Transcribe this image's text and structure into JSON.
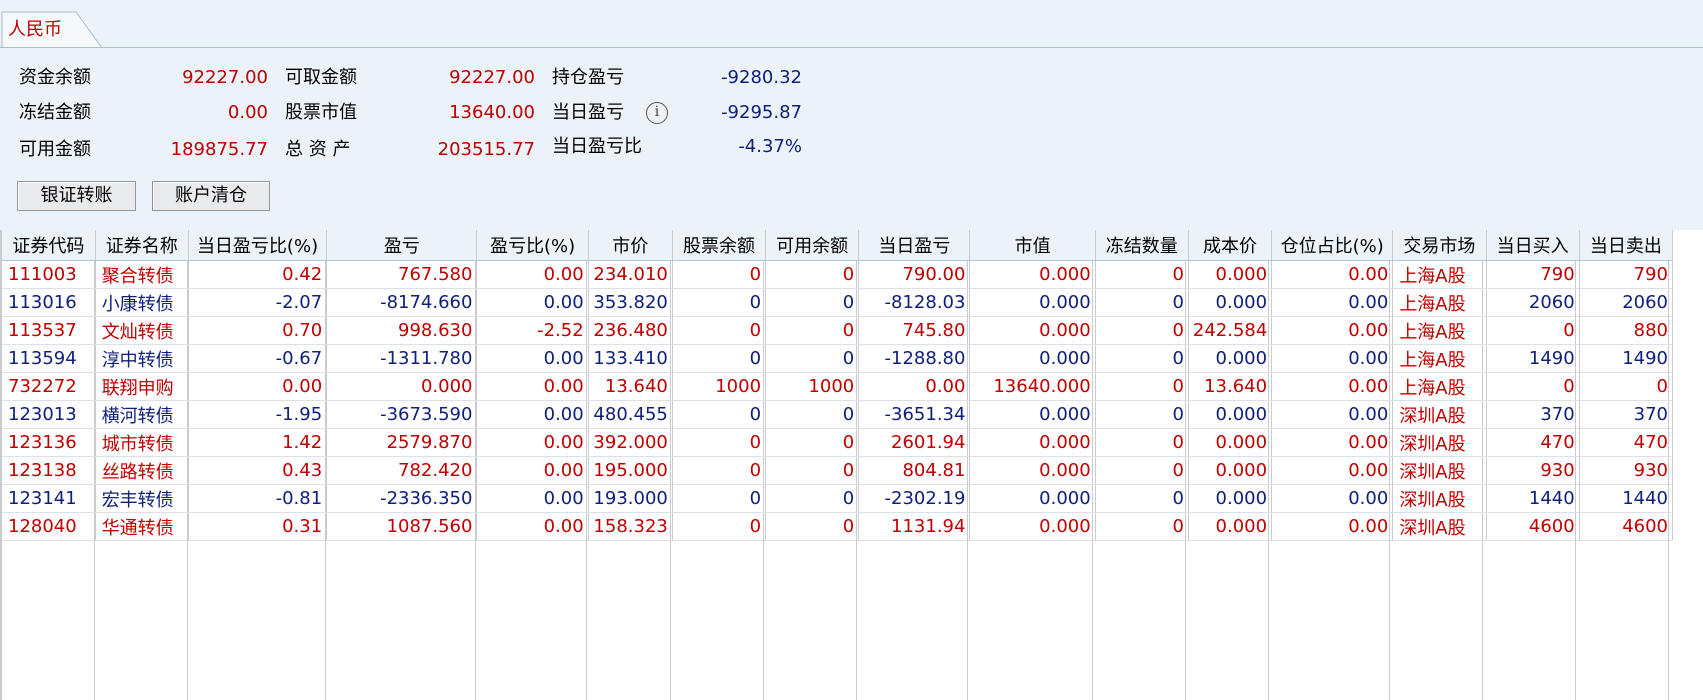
{
  "tab": {
    "label": "人民币"
  },
  "summary": [
    {
      "label": "资金余额",
      "value": "92227.00"
    },
    {
      "label": "冻结金额",
      "value": "0.00"
    },
    {
      "label": "可用金额",
      "value": "189875.77"
    },
    {
      "label": "可取金额",
      "value": "92227.00"
    },
    {
      "label": "股票市值",
      "value": "13640.00"
    },
    {
      "label": "总 资 产",
      "value": "203515.77"
    },
    {
      "label": "持仓盈亏",
      "value": "-9280.32"
    },
    {
      "label": "当日盈亏",
      "value": "-9295.87"
    },
    {
      "label": "当日盈亏比",
      "value": "-4.37%"
    }
  ],
  "buttons": {
    "transfer": "银证转账",
    "clear": "账户清仓"
  },
  "icons": {
    "info": "info-icon"
  },
  "colors": {
    "up": "#c00000",
    "down": "#10207a"
  },
  "table": {
    "columns": [
      "证券代码",
      "证券名称",
      "当日盈亏比(%)",
      "盈亏",
      "盈亏比(%)",
      "市价",
      "股票余额",
      "可用余额",
      "当日盈亏",
      "市值",
      "冻结数量",
      "成本价",
      "仓位占比(%)",
      "交易市场",
      "当日买入",
      "当日卖出"
    ],
    "rows": [
      {
        "tone": "red",
        "cells": [
          "111003",
          "聚合转债",
          "0.42",
          "767.580",
          "0.00",
          "234.010",
          "0",
          "0",
          "790.00",
          "0.000",
          "0",
          "0.000",
          "0.00",
          "上海A股",
          "790",
          "790"
        ]
      },
      {
        "tone": "blue",
        "cells": [
          "113016",
          "小康转债",
          "-2.07",
          "-8174.660",
          "0.00",
          "353.820",
          "0",
          "0",
          "-8128.03",
          "0.000",
          "0",
          "0.000",
          "0.00",
          "上海A股",
          "2060",
          "2060"
        ]
      },
      {
        "tone": "red",
        "cells": [
          "113537",
          "文灿转债",
          "0.70",
          "998.630",
          "-2.52",
          "236.480",
          "0",
          "0",
          "745.80",
          "0.000",
          "0",
          "242.584",
          "0.00",
          "上海A股",
          "0",
          "880"
        ]
      },
      {
        "tone": "blue",
        "cells": [
          "113594",
          "淳中转债",
          "-0.67",
          "-1311.780",
          "0.00",
          "133.410",
          "0",
          "0",
          "-1288.80",
          "0.000",
          "0",
          "0.000",
          "0.00",
          "上海A股",
          "1490",
          "1490"
        ]
      },
      {
        "tone": "red",
        "cells": [
          "732272",
          "联翔申购",
          "0.00",
          "0.000",
          "0.00",
          "13.640",
          "1000",
          "1000",
          "0.00",
          "13640.000",
          "0",
          "13.640",
          "0.00",
          "上海A股",
          "0",
          "0"
        ]
      },
      {
        "tone": "blue",
        "cells": [
          "123013",
          "横河转债",
          "-1.95",
          "-3673.590",
          "0.00",
          "480.455",
          "0",
          "0",
          "-3651.34",
          "0.000",
          "0",
          "0.000",
          "0.00",
          "深圳A股",
          "370",
          "370"
        ]
      },
      {
        "tone": "red",
        "cells": [
          "123136",
          "城市转债",
          "1.42",
          "2579.870",
          "0.00",
          "392.000",
          "0",
          "0",
          "2601.94",
          "0.000",
          "0",
          "0.000",
          "0.00",
          "深圳A股",
          "470",
          "470"
        ]
      },
      {
        "tone": "red",
        "cells": [
          "123138",
          "丝路转债",
          "0.43",
          "782.420",
          "0.00",
          "195.000",
          "0",
          "0",
          "804.81",
          "0.000",
          "0",
          "0.000",
          "0.00",
          "深圳A股",
          "930",
          "930"
        ]
      },
      {
        "tone": "blue",
        "cells": [
          "123141",
          "宏丰转债",
          "-0.81",
          "-2336.350",
          "0.00",
          "193.000",
          "0",
          "0",
          "-2302.19",
          "0.000",
          "0",
          "0.000",
          "0.00",
          "深圳A股",
          "1440",
          "1440"
        ]
      },
      {
        "tone": "red",
        "cells": [
          "128040",
          "华通转债",
          "0.31",
          "1087.560",
          "0.00",
          "158.323",
          "0",
          "0",
          "1131.94",
          "0.000",
          "0",
          "0.000",
          "0.00",
          "深圳A股",
          "4600",
          "4600"
        ]
      }
    ]
  }
}
